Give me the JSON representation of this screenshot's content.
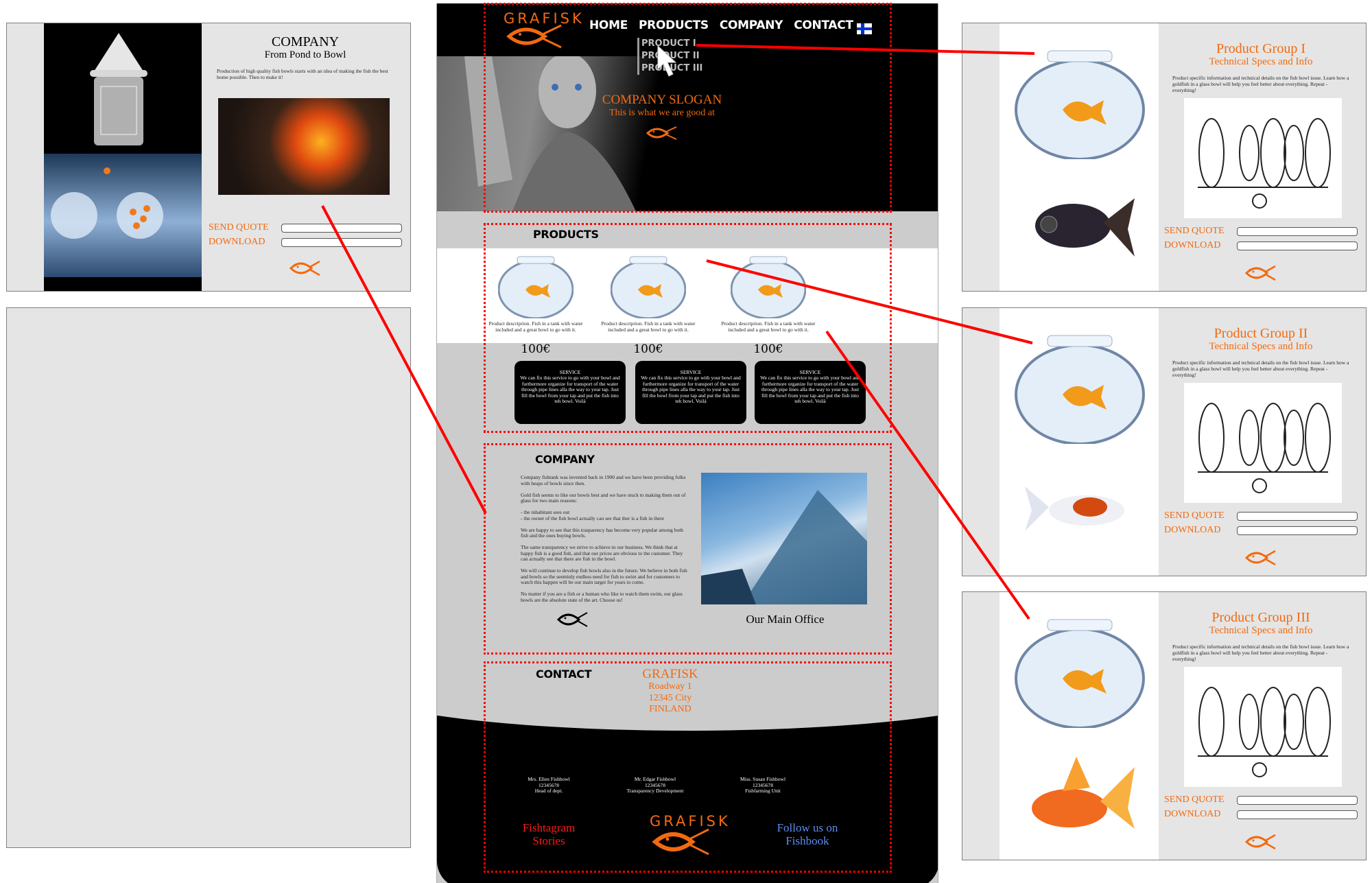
{
  "brand": {
    "name": "GRAFISK",
    "accent": "#f26a10"
  },
  "nav": {
    "items": [
      {
        "label": "HOME"
      },
      {
        "label": "PRODUCTS"
      },
      {
        "label": "COMPANY"
      },
      {
        "label": "CONTACT"
      }
    ],
    "language_flag": "finland-flag-icon",
    "dropdown": [
      {
        "label": "PRODUCT I"
      },
      {
        "label": "PRODUCT II"
      },
      {
        "label": "PRODUCT III"
      }
    ]
  },
  "hero": {
    "slogan": "COMPANY SLOGAN",
    "tagline": "This is what we are good at"
  },
  "products": {
    "title": "PRODUCTS",
    "items": [
      {
        "description": "Product descriprion. Fish in a tank with water included and a great bowl to go with it.",
        "price": "100€",
        "service_title": "SERVICE",
        "service_text": "We can fix this service to go with your bowl and furthermore organize for transport of the water through pipe lines alla the way to your tap. Just fill the bowl from your tap and put the fish into teh bowl. Voilá"
      },
      {
        "description": "Product descriprion. Fish in a tank with water included and a great bowl to go with it.",
        "price": "100€",
        "service_title": "SERVICE",
        "service_text": "We can fix this service to go with your bowl and furthermore organize for transport of the water through pipe lines alla the way to your tap. Just fill the bowl from your tap and put the fish into teh bowl. Voilá"
      },
      {
        "description": "Product descriprion. Fish in a tank with water included and a great bowl to go with it.",
        "price": "100€",
        "service_title": "SERVICE",
        "service_text": "We can fix this service to go with your bowl and furthermore organize for transport of the water through pipe lines alla the way to your tap. Just fill the bowl from your tap and put the fish into teh bowl. Voilá"
      }
    ]
  },
  "company": {
    "title": "COMPANY",
    "paragraphs": [
      "Company fishtank was invented back in 1900 and we have been providing folks with heaps of bowls since then.",
      "Gold fish seems to like our bowls best and we have stuck to making them out of glass for two main reasons:",
      "- the inhabitant sees out\n- the owner of the fish bowl actually can see that ther is a fish in there",
      "We are happy to see that this trasparency has become very popular among both fish and the ones buying bowls.",
      "The same transparency we strive to achieve in our business. We think that at happy fish is a good fish, and that our prices are obvious to the customer. They can actually see that there are fish in the bowl.",
      "We will continue to develop fish bowls also in the future. We believe in both fish and bowls so the seeminly endless need for fish to swim and for customers to watch this happen will be our main target for years to come.",
      "No matter if you are a fish or a human who like to watch them swim, our glass bowls are the absolute state of the art. Choose us!"
    ],
    "image_caption": "Our Main Office"
  },
  "contact": {
    "title": "CONTACT",
    "address": {
      "name": "GRAFISK",
      "street": "Roadway 1",
      "city": "12345 City",
      "country": "FINLAND"
    },
    "people": [
      {
        "name": "Mrs. Ellen Fishbowl",
        "phone": "12345678",
        "role": "Head of dept."
      },
      {
        "name": "Mr. Edgar Fishbowl",
        "phone": "12345678",
        "role": "Transparency Development"
      },
      {
        "name": "Miss. Susan Fishbowl",
        "phone": "12345678",
        "role": "Fishfarming Unit"
      }
    ],
    "social_left": {
      "line1": "Fishtagram",
      "line2": "Stories",
      "color": "#ff1a1a"
    },
    "social_right": {
      "line1": "Follow us on",
      "line2": "Fishbook",
      "color": "#5b8def"
    }
  },
  "company_page": {
    "title": "COMPANY",
    "subtitle": "From Pond to Bowl",
    "body": "Production of high quality fish bowls starts with an idea of making the fish the best home possible. Then to make it!",
    "send_quote": "SEND QUOTE",
    "download": "DOWNLOAD"
  },
  "product_pages": [
    {
      "title": "Product Group I",
      "subtitle": "Technical Specs and Info",
      "body": "Product specific information and technical details on the fish bowl issue. Learn how a goldfish in a glass bowl will help you feel better about everything. Repeat - everything!",
      "send_quote": "SEND QUOTE",
      "download": "DOWNLOAD"
    },
    {
      "title": "Product Group II",
      "subtitle": "Technical Specs and Info",
      "body": "Product specific information and technical details on the fish bowl issue. Learn how a goldfish in a glass bowl will help you feel better about everything. Repeat - everything!",
      "send_quote": "SEND QUOTE",
      "download": "DOWNLOAD"
    },
    {
      "title": "Product Group III",
      "subtitle": "Technical Specs and Info",
      "body": "Product specific information and technical details on the fish bowl issue. Learn how a goldfish in a glass bowl will help you feel better about everything. Repeat - everything!",
      "send_quote": "SEND QUOTE",
      "download": "DOWNLOAD"
    }
  ]
}
